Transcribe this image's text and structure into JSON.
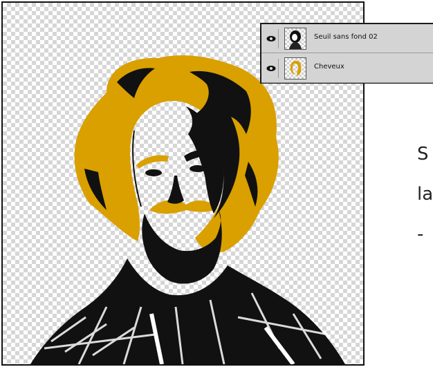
{
  "colors": {
    "hair_layer": "#d9a000",
    "ink": "#111111",
    "panel_bg": "#d4d4d4"
  },
  "canvas": {
    "subject": "posterized-portrait",
    "background": "transparency-checkerboard"
  },
  "layers_panel": {
    "layers": [
      {
        "name": "Seuil sans fond 02",
        "visible": true,
        "thumbnail_icon": "portrait-thumbnail-icon"
      },
      {
        "name": "Cheveux",
        "visible": true,
        "thumbnail_icon": "hair-shape-thumbnail-icon"
      }
    ]
  },
  "side_text": {
    "line1": "S",
    "line2": "la",
    "line3": "-"
  }
}
